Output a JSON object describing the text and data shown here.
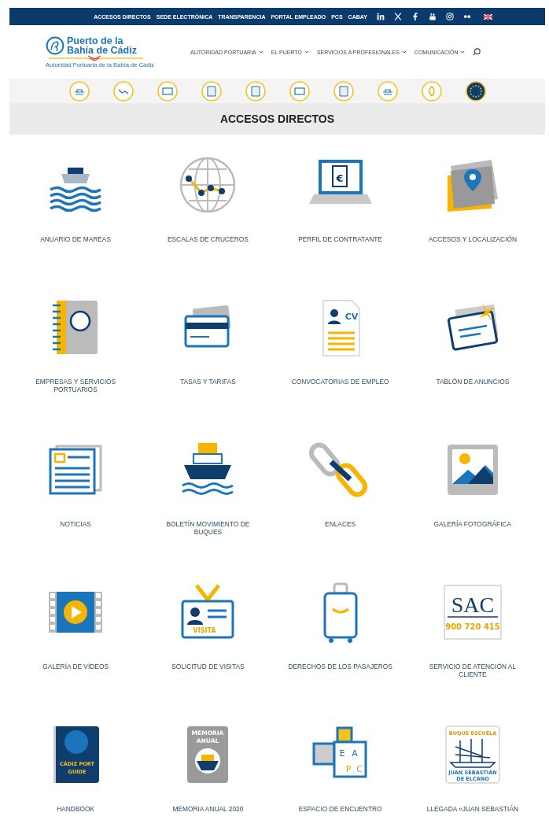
{
  "top_bar": {
    "links": [
      "ACCESOS DIRECTOS",
      "SEDE ELECTRÓNICA",
      "TRANSPARENCIA",
      "PORTAL EMPLEADO",
      "PCS",
      "CABAY"
    ]
  },
  "header": {
    "logo_title": "Puerto de la Bahía de Cádiz",
    "logo_subtitle": "Autoridad Portuaria de la Bahía de Cádiz",
    "nav": [
      "AUTORIDAD PORTUARIA",
      "EL PUERTO",
      "SERVICIOS A PROFESIONALES",
      "COMUNICACIÓN"
    ]
  },
  "section_title": "ACCESOS DIRECTOS",
  "tiles": [
    {
      "label": "ANUARIO DE MAREAS"
    },
    {
      "label": "ESCALAS DE CRUCEROS"
    },
    {
      "label": "PERFIL DE CONTRATANTE",
      "icon_text": [
        "€"
      ]
    },
    {
      "label": "ACCESOS Y LOCALIZACIÓN"
    },
    {
      "label": "EMPRESAS Y SERVICIOS PORTUARIOS"
    },
    {
      "label": "TASAS Y TARIFAS"
    },
    {
      "label": "CONVOCATORIAS DE EMPLEO",
      "icon_text": [
        "CV"
      ]
    },
    {
      "label": "TABLÓN DE ANUNCIOS"
    },
    {
      "label": "NOTICIAS"
    },
    {
      "label": "BOLETÍN MOVIMIENTO DE BUQUES"
    },
    {
      "label": "ENLACES"
    },
    {
      "label": "GALERÍA FOTOGRÁFICA"
    },
    {
      "label": "GALERÍA DE VÍDEOS"
    },
    {
      "label": "SOLICITUD DE VISITAS",
      "icon_text": [
        "VISITA"
      ]
    },
    {
      "label": "DERECHOS DE LOS PASAJEROS"
    },
    {
      "label": "SERVICIO DE ATENCIÓN AL CLIENTE",
      "icon_text": [
        "SAC",
        "900 720 415"
      ]
    },
    {
      "label": "HANDBOOK",
      "icon_text": [
        "CÁDIZ PORT",
        "GUIDE"
      ]
    },
    {
      "label": "MEMORIA ANUAL 2020",
      "icon_text": [
        "MEMORIA",
        "ANUAL"
      ]
    },
    {
      "label": "ESPACIO DE ENCUENTRO",
      "icon_text": [
        "E",
        "A",
        "P",
        "C"
      ]
    },
    {
      "label": "LLEGADA «JUAN SEBASTIÁN",
      "icon_text": [
        "BUQUE ESCUELA",
        "JUAN SEBASTIÁN",
        "DE ELCANO"
      ]
    }
  ]
}
